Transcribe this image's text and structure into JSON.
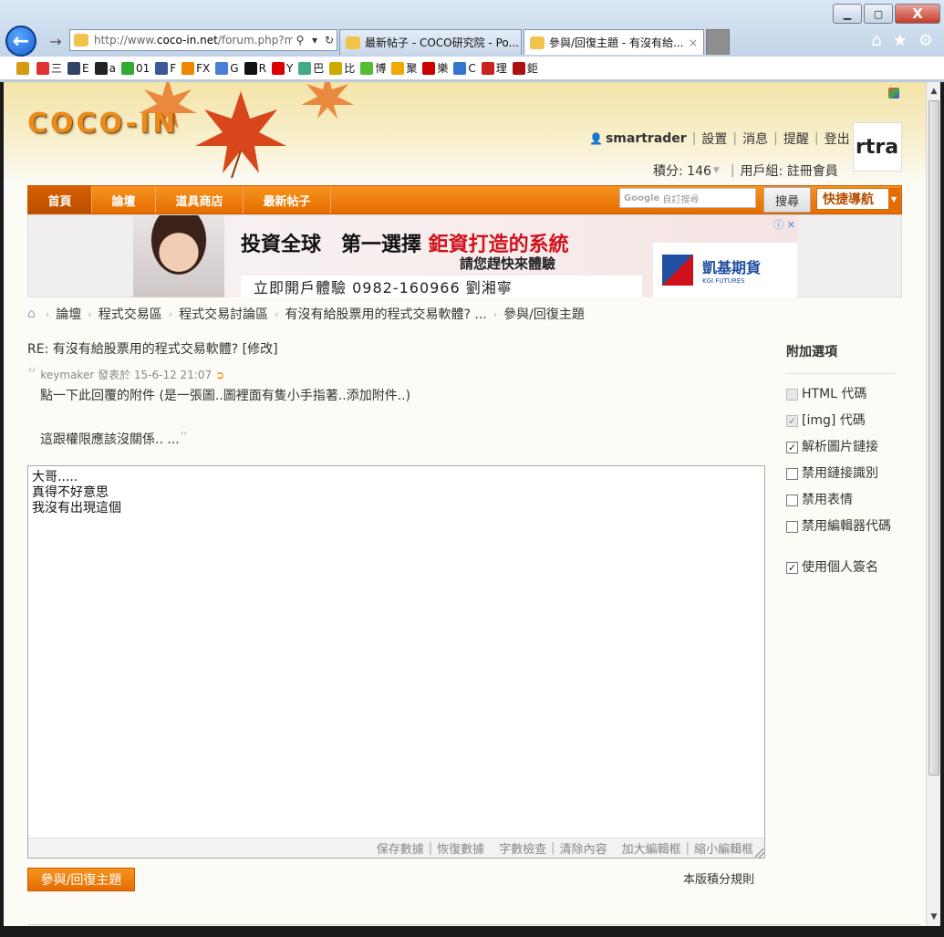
{
  "browser": {
    "address": {
      "prefix": "http://www.",
      "host": "coco-in.net",
      "path": "/forum.php?m"
    },
    "tabs": [
      {
        "label": "最新帖子 - COCO研究院 - Po..."
      },
      {
        "label": "參與/回復主題 - 有沒有給...",
        "close": "×"
      }
    ],
    "window_controls": {
      "minimize": "▁",
      "maximize": "▢",
      "close": "X"
    },
    "right_icons": {
      "home": "⌂",
      "favorites": "★",
      "settings": "⚙"
    },
    "favorites_bar": [
      {
        "label": "",
        "icon": "star-icon",
        "color": "#d89a12"
      },
      {
        "label": "三",
        "icon": "bookmark-icon",
        "color": "#d33"
      },
      {
        "label": "E",
        "icon": "bookmark-icon",
        "color": "#346"
      },
      {
        "label": "a",
        "icon": "amazon-icon",
        "color": "#222"
      },
      {
        "label": "01",
        "icon": "bookmark-icon",
        "color": "#3a3"
      },
      {
        "label": "F",
        "icon": "facebook-icon",
        "color": "#3b5998"
      },
      {
        "label": "FX",
        "icon": "bookmark-icon",
        "color": "#e80"
      },
      {
        "label": "G",
        "icon": "google-icon",
        "color": "#4a7fd8"
      },
      {
        "label": "R",
        "icon": "bookmark-icon",
        "color": "#111"
      },
      {
        "label": "Y",
        "icon": "youtube-icon",
        "color": "#d00"
      },
      {
        "label": "巴",
        "icon": "bookmark-icon",
        "color": "#4a8"
      },
      {
        "label": "比",
        "icon": "bookmark-icon",
        "color": "#ca0"
      },
      {
        "label": "博",
        "icon": "mail-icon",
        "color": "#5b3"
      },
      {
        "label": "聚",
        "icon": "bookmark-icon",
        "color": "#ea0"
      },
      {
        "label": "樂",
        "icon": "bookmark-icon",
        "color": "#c00"
      },
      {
        "label": "C",
        "icon": "ie-icon",
        "color": "#37c"
      },
      {
        "label": "理",
        "icon": "bookmark-icon",
        "color": "#c22"
      },
      {
        "label": "鉅",
        "icon": "bookmark-icon",
        "color": "#a11"
      }
    ]
  },
  "site": {
    "logo": "COCO-IN",
    "user": {
      "name": "smartrader",
      "links": [
        "設置",
        "消息",
        "提醒",
        "登出"
      ],
      "avatar_text": "rtra",
      "credits_label": "積分: 146",
      "group_label": "用戶組: 註冊會員"
    },
    "nav": [
      "首頁",
      "論壇",
      "道具商店",
      "最新帖子"
    ],
    "search": {
      "google_label": "Google",
      "placeholder": "自訂搜尋",
      "button": "搜尋",
      "quicknav": "快捷導航"
    }
  },
  "ad": {
    "title_black": "投資全球　第一選擇 ",
    "title_red": "鉅資打造的系統",
    "subtitle": "請您趕快來體驗",
    "band": "立即開戶體驗 0982-160966 劉湘寧",
    "brand": "凱基期貨",
    "brand_sub": "KGI FUTURES",
    "close": "ⓘ ✕"
  },
  "breadcrumb": [
    "論壇",
    "程式交易區",
    "程式交易討論區",
    "有沒有給股票用的程式交易軟體? ...",
    "參與/回復主題"
  ],
  "post": {
    "title": "RE: 有沒有給股票用的程式交易軟體? [修改]",
    "quote_author": "keymaker",
    "quote_meta": "發表於 15-6-12 21:07",
    "quote_line1": "點一下此回覆的附件 (是一張圖..圖裡面有隻小手指著..添加附件..)",
    "quote_line2": "這跟權限應該沒關係.. ...",
    "body": "大哥.....\n真得不好意思\n我沒有出現這個"
  },
  "editor_actions": [
    "保存數據",
    "恢復數據",
    "字數檢查",
    "清除內容",
    "加大編輯框",
    "縮小編輯框"
  ],
  "submit_label": "參與/回復主題",
  "rules_label": "本版積分規則",
  "options": {
    "title": "附加選項",
    "items": [
      {
        "label": "HTML 代碼",
        "checked": false,
        "disabled": true
      },
      {
        "label": "[img] 代碼",
        "checked": true,
        "disabled": true
      },
      {
        "label": "解析圖片鏈接",
        "checked": true,
        "disabled": false
      },
      {
        "label": "禁用鏈接識別",
        "checked": false,
        "disabled": false
      },
      {
        "label": "禁用表情",
        "checked": false,
        "disabled": false
      },
      {
        "label": "禁用編輯器代碼",
        "checked": false,
        "disabled": false
      },
      {
        "label": "使用個人簽名",
        "checked": true,
        "disabled": false
      }
    ]
  },
  "colors": {
    "accent_orange": "#e56c00",
    "page_bg": "#fcfbf6",
    "header_yellow": "#f4e4a8"
  }
}
